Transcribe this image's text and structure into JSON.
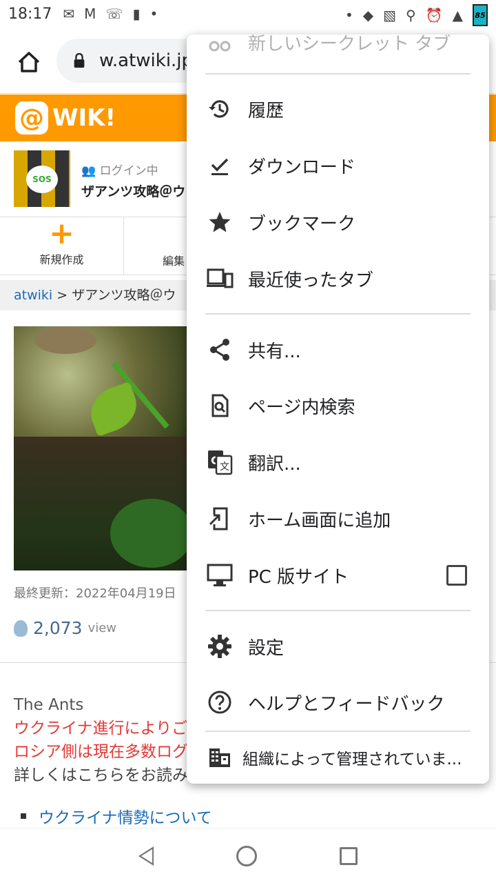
{
  "status_bar": {
    "time": "18:17",
    "battery": "85"
  },
  "toolbar": {
    "url": "w.atwiki.jp/"
  },
  "site": {
    "logo_text": "WIK!",
    "login_label": "ログイン中",
    "wiki_name": "ザアンツ攻略＠ウ",
    "new_page": "新規作成",
    "edit": "編集",
    "breadcrumb_root": "atwiki",
    "breadcrumb_rest": " > ザアンツ攻略＠ウ",
    "updated": "最終更新：2022年04月19日",
    "views_count": "2,073",
    "views_unit": "view",
    "text_en": "The Ants",
    "text_red1": "ウクライナ進行によりご",
    "text_red2": "ロシア側は現在多数ログ",
    "text_plain": "詳しくはこちらをお読み",
    "bullet_link": "ウクライナ情勢について"
  },
  "menu": {
    "top_partial": "新しいシークレット タブ",
    "history": "履歴",
    "downloads": "ダウンロード",
    "bookmarks": "ブックマーク",
    "recent_tabs": "最近使ったタブ",
    "share": "共有...",
    "find_in_page": "ページ内検索",
    "translate": "翻訳...",
    "add_to_home": "ホーム画面に追加",
    "desktop_site": "PC 版サイト",
    "desktop_site_checked": false,
    "settings": "設定",
    "help": "ヘルプとフィードバック",
    "managed": "組織によって管理されていま..."
  }
}
